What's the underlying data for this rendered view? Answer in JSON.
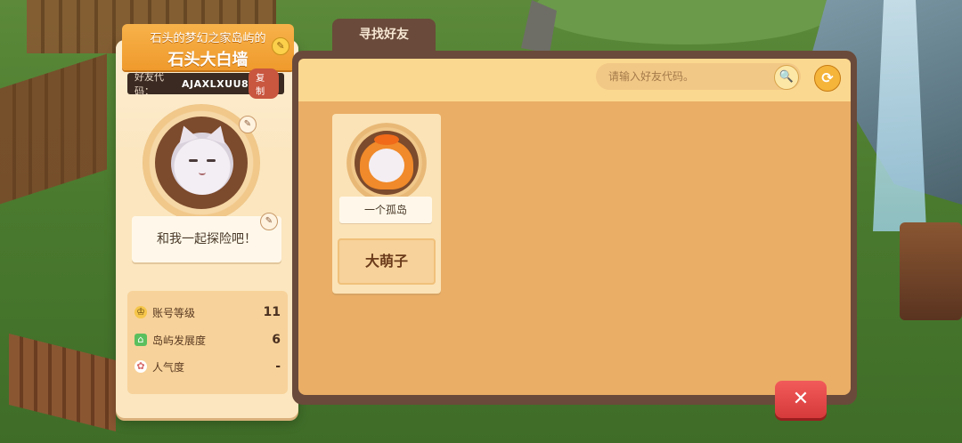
{
  "profile": {
    "island_title": "石头的梦幻之家岛屿的",
    "name": "石头大白墙",
    "friend_code_label": "好友代码：",
    "friend_code": "AJAXLXUU8",
    "copy_label": "复制",
    "motto": "和我一起探险吧！",
    "stats": [
      {
        "label": "账号等级",
        "value": "11",
        "icon": "crown-icon"
      },
      {
        "label": "岛屿发展度",
        "value": "6",
        "icon": "house-icon"
      },
      {
        "label": "人气度",
        "value": "-",
        "icon": "paw-icon"
      }
    ]
  },
  "panel": {
    "tab_label": "寻找好友",
    "search_placeholder": "请输入好友代码。"
  },
  "friends": [
    {
      "island": "一个孤岛",
      "name": "大萌子"
    }
  ],
  "icons": {
    "edit": "✎",
    "search": "🔍",
    "refresh": "⟳",
    "close": "✕",
    "crown": "♔",
    "house": "⌂",
    "paw": "✿"
  }
}
